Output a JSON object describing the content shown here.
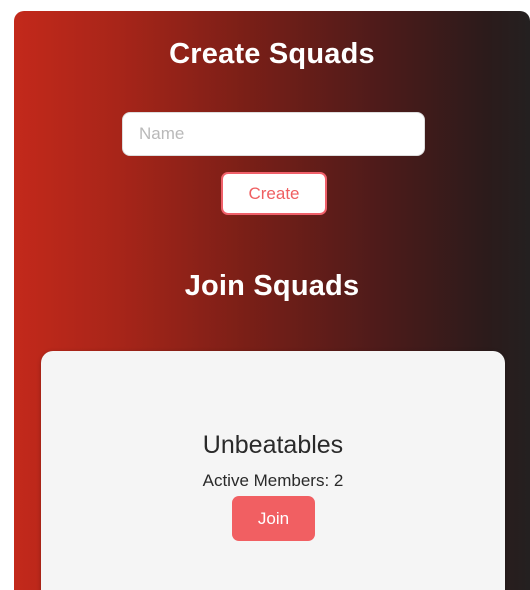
{
  "create_section": {
    "title": "Create Squads",
    "name_input": {
      "placeholder": "Name",
      "value": ""
    },
    "create_button_label": "Create"
  },
  "join_section": {
    "title": "Join Squads",
    "squads": [
      {
        "name": "Unbeatables",
        "active_members_text": "Active Members: 2",
        "join_button_label": "Join"
      }
    ]
  },
  "colors": {
    "gradient_left": "#c3291b",
    "gradient_right": "#242020",
    "accent": "#f15f62",
    "card_background": "#f5f5f5"
  }
}
